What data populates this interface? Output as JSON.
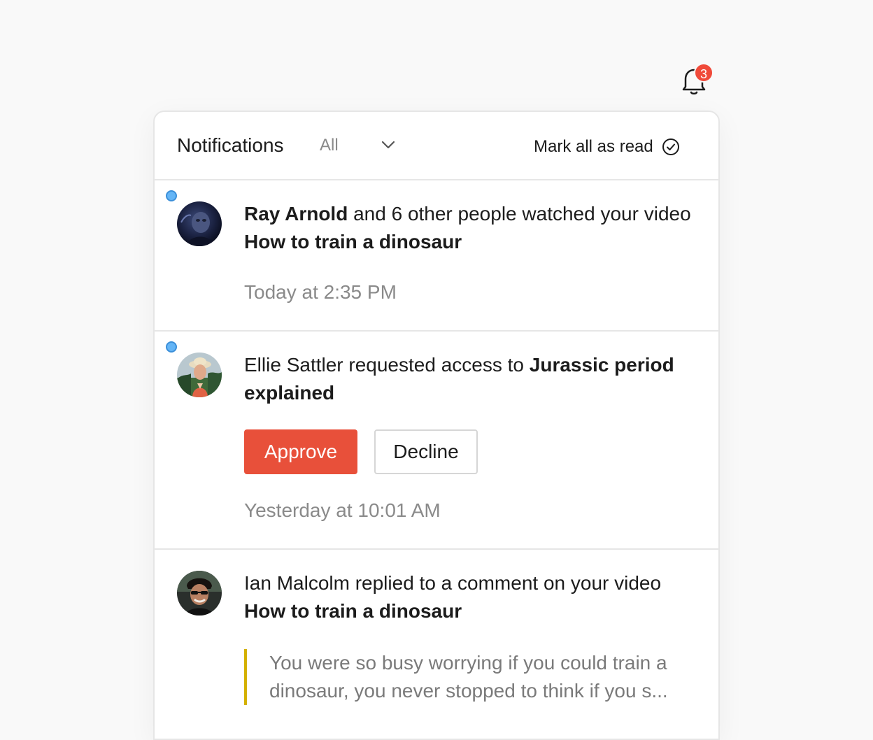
{
  "bell": {
    "icon": "bell-icon",
    "badge_count": "3",
    "badge_color": "#f04a3a"
  },
  "panel": {
    "title": "Notifications",
    "filter": {
      "selected": "All",
      "icon": "chevron-down-icon"
    },
    "mark_all_read": {
      "label": "Mark all as read",
      "icon": "check-circle-icon"
    }
  },
  "notifications": [
    {
      "unread": true,
      "avatar": "ray-arnold-avatar",
      "actor": "Ray Arnold",
      "text_middle": " and 6 other people watched your video ",
      "object": "How to train a dinosaur",
      "timestamp": "Today at 2:35 PM"
    },
    {
      "unread": true,
      "avatar": "ellie-sattler-avatar",
      "text_prefix": "Ellie Sattler requested access to ",
      "object": "Jurassic period explained",
      "approve_label": "Approve",
      "decline_label": "Decline",
      "timestamp": "Yesterday at 10:01 AM"
    },
    {
      "unread": false,
      "avatar": "ian-malcolm-avatar",
      "text_prefix": "Ian Malcolm replied to a comment on your video ",
      "object": "How to train a dinosaur",
      "quote": "You were so busy worrying if you could train a dinosaur, you never stopped to think if you s..."
    }
  ],
  "colors": {
    "accent": "#e8503a",
    "unread_dot": "#64b5f6",
    "quote_bar": "#d4b100"
  }
}
